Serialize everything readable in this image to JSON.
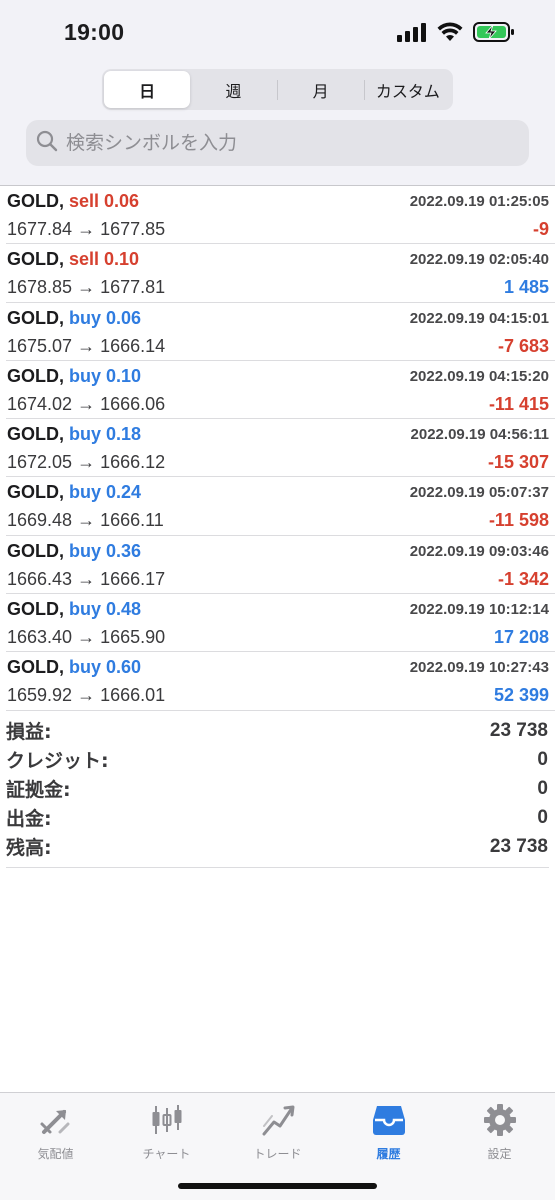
{
  "status_bar": {
    "time": "19:00"
  },
  "period_tabs": [
    {
      "label": "日",
      "active": true
    },
    {
      "label": "週",
      "active": false
    },
    {
      "label": "月",
      "active": false
    },
    {
      "label": "カスタム",
      "active": false
    }
  ],
  "search": {
    "placeholder": "検索シンボルを入力",
    "value": ""
  },
  "deals": [
    {
      "symbol": "GOLD,",
      "side": "sell 0.06",
      "type": "sell",
      "datetime": "2022.09.19 01:25:05",
      "prices": "1677.84 → 1677.85",
      "profit": "-9",
      "sign": "neg"
    },
    {
      "symbol": "GOLD,",
      "side": "sell 0.10",
      "type": "sell",
      "datetime": "2022.09.19 02:05:40",
      "prices": "1678.85 → 1677.81",
      "profit": "1 485",
      "sign": "pos"
    },
    {
      "symbol": "GOLD,",
      "side": "buy 0.06",
      "type": "buy",
      "datetime": "2022.09.19 04:15:01",
      "prices": "1675.07 → 1666.14",
      "profit": "-7 683",
      "sign": "neg"
    },
    {
      "symbol": "GOLD,",
      "side": "buy 0.10",
      "type": "buy",
      "datetime": "2022.09.19 04:15:20",
      "prices": "1674.02 → 1666.06",
      "profit": "-11 415",
      "sign": "neg"
    },
    {
      "symbol": "GOLD,",
      "side": "buy 0.18",
      "type": "buy",
      "datetime": "2022.09.19 04:56:11",
      "prices": "1672.05 → 1666.12",
      "profit": "-15 307",
      "sign": "neg"
    },
    {
      "symbol": "GOLD,",
      "side": "buy 0.24",
      "type": "buy",
      "datetime": "2022.09.19 05:07:37",
      "prices": "1669.48 → 1666.11",
      "profit": "-11 598",
      "sign": "neg"
    },
    {
      "symbol": "GOLD,",
      "side": "buy 0.36",
      "type": "buy",
      "datetime": "2022.09.19 09:03:46",
      "prices": "1666.43 → 1666.17",
      "profit": "-1 342",
      "sign": "neg"
    },
    {
      "symbol": "GOLD,",
      "side": "buy 0.48",
      "type": "buy",
      "datetime": "2022.09.19 10:12:14",
      "prices": "1663.40 → 1665.90",
      "profit": "17 208",
      "sign": "pos"
    },
    {
      "symbol": "GOLD,",
      "side": "buy 0.60",
      "type": "buy",
      "datetime": "2022.09.19 10:27:43",
      "prices": "1659.92 → 1666.01",
      "profit": "52 399",
      "sign": "pos"
    }
  ],
  "summary": [
    {
      "label": "損益:",
      "value": "23 738"
    },
    {
      "label": "クレジット:",
      "value": "0"
    },
    {
      "label": "証拠金:",
      "value": "0"
    },
    {
      "label": "出金:",
      "value": "0"
    },
    {
      "label": "残高:",
      "value": "23 738"
    }
  ],
  "tab_bar": [
    {
      "label": "気配値",
      "icon": "quotes-arrows-icon",
      "active": false
    },
    {
      "label": "チャート",
      "icon": "candlestick-chart-icon",
      "active": false
    },
    {
      "label": "トレード",
      "icon": "trade-line-icon",
      "active": false
    },
    {
      "label": "履歴",
      "icon": "history-inbox-icon",
      "active": true
    },
    {
      "label": "設定",
      "icon": "gear-icon",
      "active": false
    }
  ],
  "colors": {
    "sell": "#d6402f",
    "buy": "#2f7ce0",
    "negative": "#d6402f",
    "positive": "#2f7ce0",
    "active_tab": "#2f7ce0",
    "inactive_tab": "#8e8e93"
  }
}
